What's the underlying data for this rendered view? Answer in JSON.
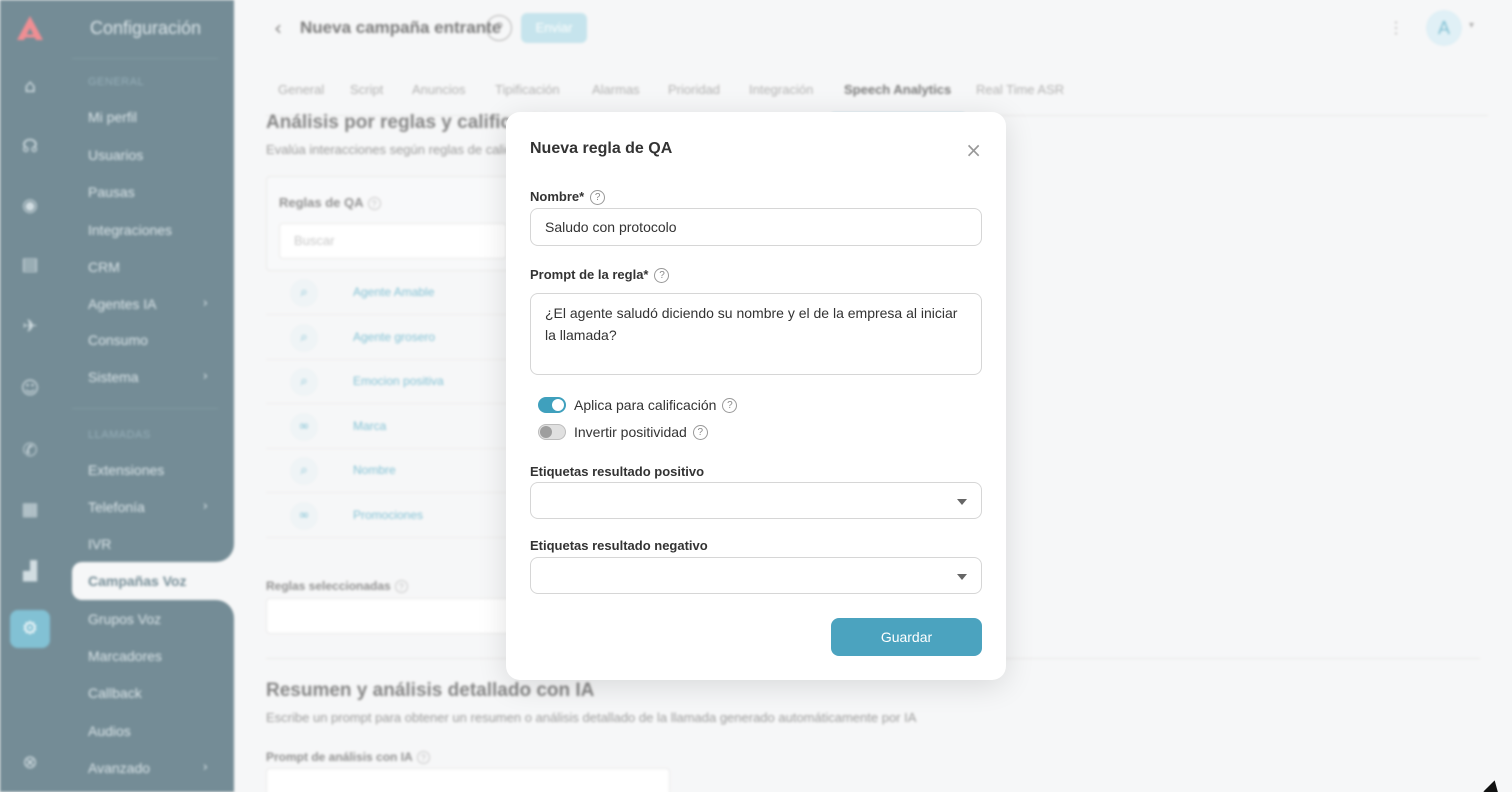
{
  "app": {
    "menu_title": "Configuración",
    "sections": {
      "general": "GENERAL",
      "llamadas": "LLAMADAS"
    },
    "menu_items": [
      {
        "label": "Mi perfil"
      },
      {
        "label": "Usuarios"
      },
      {
        "label": "Pausas"
      },
      {
        "label": "Integraciones"
      },
      {
        "label": "CRM"
      },
      {
        "label": "Agentes IA",
        "has_submenu": true
      },
      {
        "label": "Consumo"
      },
      {
        "label": "Sistema",
        "has_submenu": true
      },
      {
        "label": "Extensiones"
      },
      {
        "label": "Telefonía",
        "has_submenu": true
      },
      {
        "label": "IVR"
      },
      {
        "label": "Campañas Voz",
        "active": true
      },
      {
        "label": "Grupos Voz"
      },
      {
        "label": "Marcadores"
      },
      {
        "label": "Callback"
      },
      {
        "label": "Audios"
      },
      {
        "label": "Avanzado",
        "has_submenu": true
      }
    ],
    "rail_icons": [
      "home-icon",
      "headset-icon",
      "eye-icon",
      "book-icon",
      "rocket-icon",
      "robot-icon",
      "phone-off-icon",
      "calendar-icon",
      "chart-icon",
      "gear-icon",
      "help-circle-icon"
    ]
  },
  "topbar": {
    "back_glyph": "‹",
    "title": "Nueva campaña entrante",
    "help": "?",
    "save_label": "Enviar",
    "avatar_initial": "A"
  },
  "tabs": [
    "General",
    "Script",
    "Anuncios",
    "Tipificación",
    "Alarmas",
    "Prioridad",
    "Integración",
    "Speech Analytics",
    "Real Time ASR"
  ],
  "active_tab": "Speech Analytics",
  "content": {
    "section1_title": "Análisis por reglas y calificación",
    "section1_desc": "Evalúa interacciones según reglas de calidad",
    "rules_label": "Reglas de QA",
    "search_placeholder": "Buscar",
    "rules": [
      {
        "name": "Agente Amable",
        "icon": "search-icon"
      },
      {
        "name": "Agente grosero",
        "icon": "search-icon"
      },
      {
        "name": "Emocion positiva",
        "icon": "search-icon"
      },
      {
        "name": "Marca",
        "icon": "link-icon"
      },
      {
        "name": "Nombre",
        "icon": "search-icon"
      },
      {
        "name": "Promociones",
        "icon": "link-icon"
      }
    ],
    "selected_label": "Reglas seleccionadas",
    "section2_title": "Resumen y análisis detallado con IA",
    "section2_desc": "Escribe un prompt para obtener un resumen o análisis detallado de la llamada generado automáticamente por IA",
    "prompt_label": "Prompt de análisis con IA"
  },
  "modal": {
    "title": "Nueva regla de QA",
    "close_glyph": "×",
    "name_label": "Nombre*",
    "name_value": "Saludo con protocolo",
    "prompt_label": "Prompt de la regla*",
    "prompt_value": "¿El agente saludó diciendo su nombre y el de la empresa al iniciar la llamada?",
    "toggle_apply_label": "Aplica para calificación",
    "toggle_apply_on": true,
    "toggle_invert_label": "Invertir positividad",
    "toggle_invert_on": false,
    "positive_tags_label": "Etiquetas resultado positivo",
    "positive_tags_value": "",
    "negative_tags_label": "Etiquetas resultado negativo",
    "negative_tags_value": "",
    "save_label": "Guardar"
  },
  "colors": {
    "sidebar": "#2a4f5e",
    "accent": "#3fa0bd",
    "button": "#4ba3bf"
  }
}
